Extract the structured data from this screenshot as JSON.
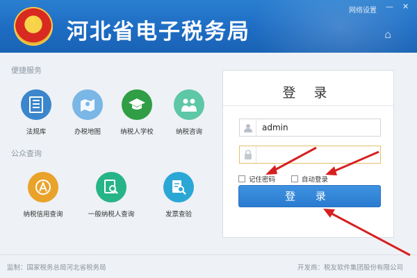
{
  "header": {
    "app_title": "河北省电子税务局",
    "network_settings": "网络设置",
    "minimize_symbol": "—",
    "close_symbol": "✕",
    "home_symbol": "⌂"
  },
  "sections": {
    "quick_services": "便捷服务",
    "public_query": "公众查询"
  },
  "quick_services": [
    {
      "label": "法规库",
      "icon": "book-icon",
      "color": "#3b86cc"
    },
    {
      "label": "办税地图",
      "icon": "map-icon",
      "color": "#7ab6e6"
    },
    {
      "label": "纳税人学校",
      "icon": "graduation-cap-icon",
      "color": "#2f9e45"
    },
    {
      "label": "纳税咨询",
      "icon": "people-icon",
      "color": "#5ec7a6"
    }
  ],
  "public_queries": [
    {
      "label": "纳税信用查询",
      "icon": "credit-a-icon",
      "color": "#e9a22a"
    },
    {
      "label": "一般纳税人查询",
      "icon": "taxpayer-search-icon",
      "color": "#27b487"
    },
    {
      "label": "发票查验",
      "icon": "invoice-search-icon",
      "color": "#2ba7d6"
    }
  ],
  "login": {
    "title": "登 录",
    "username_value": "admin",
    "password_value": "",
    "remember_label": "记住密码",
    "auto_login_label": "自动登录",
    "button_label": "登 录"
  },
  "footer": {
    "supervisor": "监制：国家税务总局河北省税务局",
    "developer": "开发商：税友软件集团股份有限公司"
  },
  "annotation_color": "#d62020"
}
